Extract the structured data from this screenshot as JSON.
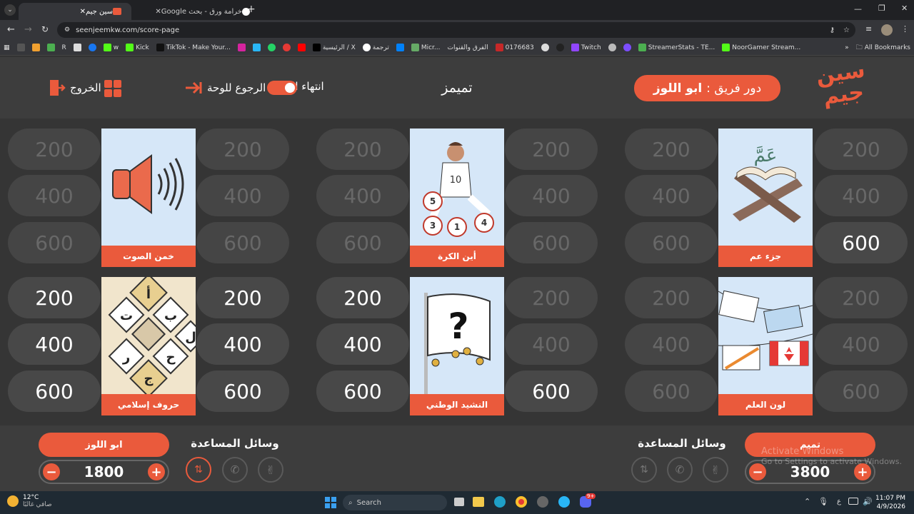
{
  "browser": {
    "tabs": [
      {
        "title": "سين جيم",
        "active": true
      },
      {
        "title": "خرامة ورق - بحث Google",
        "active": false
      }
    ],
    "url": "seenjeemkw.com/score-page",
    "bookmarks": [
      "Kick",
      "TikTok - Make Your...",
      "الرئيسية / X",
      "ترجمة",
      "Micr...",
      "الفرق والقنوات",
      "0176683",
      "Twitch",
      "StreamerStats - TE...",
      "NoorGamer Stream..."
    ],
    "all_bookmarks": "All Bookmarks",
    "single_letters": [
      "R",
      "w"
    ]
  },
  "header": {
    "logo_line1": "سين",
    "logo_line2": "جيم",
    "turn_label": "دور فريق :",
    "turn_team": "ابو اللوز",
    "center_title": "تميمز",
    "end_game": "انتهاء اللعبة",
    "back_to_board": "الرجوع للوحة",
    "exit": "الخروج"
  },
  "categories": [
    {
      "label": "جزء عم",
      "left_values": [
        "200",
        "400",
        "600"
      ],
      "right_values": [
        "200",
        "400",
        "600"
      ],
      "left_active": [
        false,
        false,
        false
      ],
      "right_active": [
        false,
        false,
        true
      ]
    },
    {
      "label": "أين الكرة",
      "left_values": [
        "200",
        "400",
        "600"
      ],
      "right_values": [
        "200",
        "400",
        "600"
      ],
      "left_active": [
        false,
        false,
        false
      ],
      "right_active": [
        false,
        false,
        false
      ]
    },
    {
      "label": "خمن الصوت",
      "left_values": [
        "200",
        "400",
        "600"
      ],
      "right_values": [
        "200",
        "400",
        "600"
      ],
      "left_active": [
        false,
        false,
        false
      ],
      "right_active": [
        false,
        false,
        false
      ]
    },
    {
      "label": "لون العلم",
      "left_values": [
        "200",
        "400",
        "600"
      ],
      "right_values": [
        "200",
        "400",
        "600"
      ],
      "left_active": [
        false,
        false,
        false
      ],
      "right_active": [
        false,
        false,
        false
      ]
    },
    {
      "label": "النشيد الوطني",
      "left_values": [
        "200",
        "400",
        "600"
      ],
      "right_values": [
        "200",
        "400",
        "600"
      ],
      "left_active": [
        true,
        true,
        true
      ],
      "right_active": [
        false,
        false,
        true
      ]
    },
    {
      "label": "حروف إسلامي",
      "left_values": [
        "200",
        "400",
        "600"
      ],
      "right_values": [
        "200",
        "400",
        "600"
      ],
      "left_active": [
        true,
        true,
        true
      ],
      "right_active": [
        true,
        true,
        true
      ]
    }
  ],
  "card_text": {
    "player_number": "10",
    "balls": [
      "5",
      "3",
      "1",
      "4"
    ],
    "letters": [
      "أ",
      "ب",
      "ت",
      "ل",
      "ج",
      "ر",
      "ح"
    ],
    "quran_word": "عَمَّ",
    "question_mark": "?"
  },
  "footer": {
    "team_right": {
      "name": "تميم",
      "score": "3800"
    },
    "team_left": {
      "name": "ابو اللوز",
      "score": "1800"
    },
    "aids_label": "وسائل المساعدة",
    "minus": "−",
    "plus": "+"
  },
  "watermark": {
    "line1": "Activate Windows",
    "line2": "Go to Settings to activate Windows."
  },
  "taskbar": {
    "weather_temp": "12°C",
    "weather_desc": "صافي غالبًا",
    "search_placeholder": "Search",
    "time": "11:07 PM",
    "date": "4/9/2026",
    "lang": "ع",
    "badge": "9+"
  },
  "colors": {
    "accent": "#ea5a3c",
    "header_bg": "#3d3d3d",
    "board_bg": "#353535"
  }
}
